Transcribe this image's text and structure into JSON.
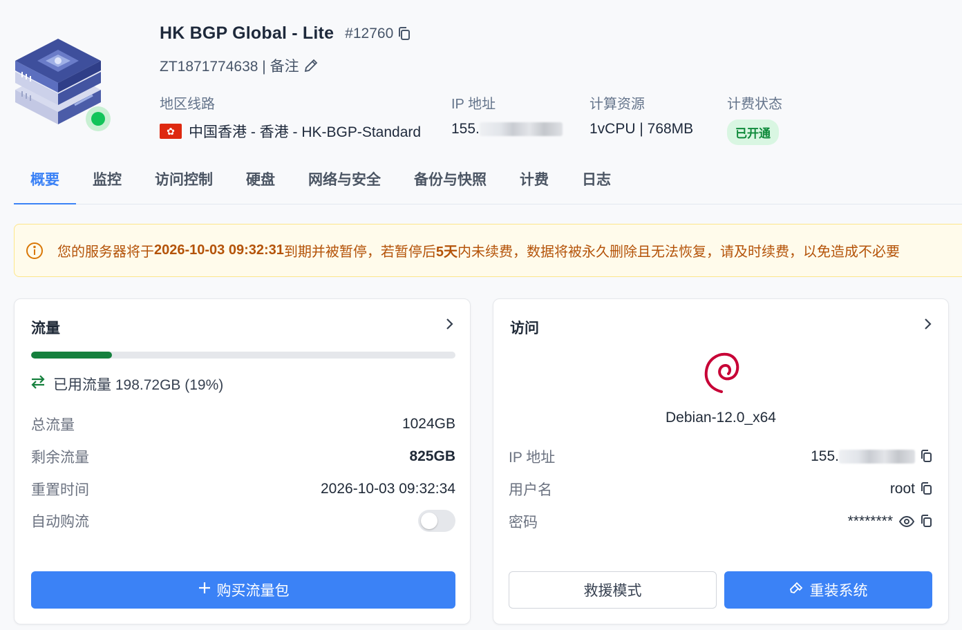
{
  "server": {
    "title": "HK BGP Global - Lite",
    "id": "#12760",
    "order_no": "ZT1871774638 | 备注"
  },
  "info": {
    "region": {
      "label": "地区线路",
      "value": "中国香港 - 香港 - HK-BGP-Standard"
    },
    "ip": {
      "label": "IP 地址",
      "value": "155."
    },
    "compute": {
      "label": "计算资源",
      "value": "1vCPU | 768MB"
    },
    "billing": {
      "label": "计费状态",
      "value": "已开通"
    }
  },
  "tabs": [
    "概要",
    "监控",
    "访问控制",
    "硬盘",
    "网络与安全",
    "备份与快照",
    "计费",
    "日志"
  ],
  "alert": {
    "prefix": "您的服务器将于 ",
    "date": "2026-10-03 09:32:31",
    "middle": " 到期并被暂停，若暂停后 ",
    "days": "5天",
    "suffix": " 内未续费，数据将被永久删除且无法恢复，请及时续费，以免造成不必要"
  },
  "traffic": {
    "title": "流量",
    "used_fraction": 0.19,
    "used_text": "已用流量 198.72GB (19%)",
    "rows": [
      {
        "label": "总流量",
        "value": "1024GB"
      },
      {
        "label": "剩余流量",
        "value": "825GB"
      },
      {
        "label": "重置时间",
        "value": "2026-10-03 09:32:34"
      },
      {
        "label": "自动购流",
        "value": ""
      }
    ],
    "auto_buy": false,
    "buy_button": "购买流量包"
  },
  "access": {
    "title": "访问",
    "os": "Debian-12.0_x64",
    "rows": [
      {
        "label": "IP 地址",
        "value": "155."
      },
      {
        "label": "用户名",
        "value": "root"
      },
      {
        "label": "密码",
        "value": "********"
      }
    ],
    "rescue_button": "救援模式",
    "reinstall_button": "重装系统"
  },
  "colors": {
    "accent": "#3b82f6",
    "success": "#12c45a",
    "progress": "#15803d",
    "warning": "#b45309"
  }
}
